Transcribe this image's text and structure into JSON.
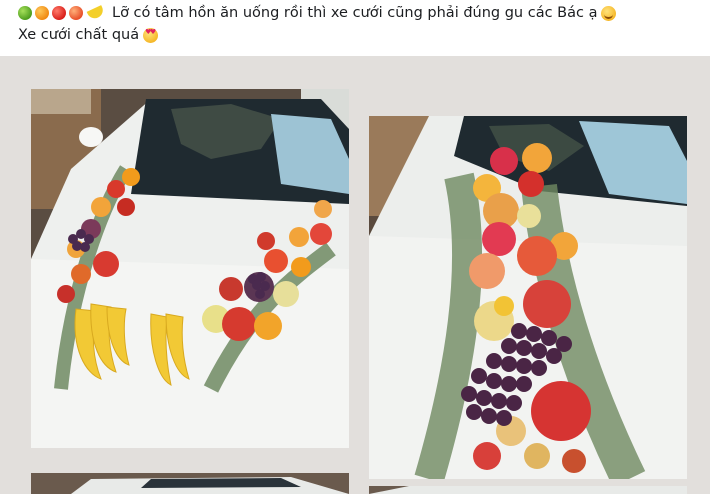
{
  "post": {
    "line1": "Lỡ có tâm hồn ăn uống rồi thì xe cưới cũng phải đúng gu các Bác ạ",
    "line2": "Xe cưới chất quá",
    "leading_emojis": [
      "green-apple-icon",
      "orange-icon",
      "red-apple-icon",
      "peach-icon",
      "banana-icon"
    ],
    "line1_trailing_emoji": "smiling-face-icon",
    "line2_trailing_emoji": "heart-eyes-icon"
  },
  "colors": {
    "background": "#ffffff",
    "gallery_background": "#e2dfdc",
    "text": "#1c1e21"
  },
  "gallery": {
    "photos": [
      {
        "subject": "white wedding car hood decorated with V-shaped fruit garland: bananas, grapes, apples, oranges and eucalyptus"
      },
      {
        "subject": "white wedding car hood with vertical fruit arrangement: dragon fruit, grapes, apples, oranges and eucalyptus"
      },
      {
        "subject": "partial photo cut off at bottom"
      },
      {
        "subject": "partial photo cut off at bottom"
      }
    ]
  }
}
